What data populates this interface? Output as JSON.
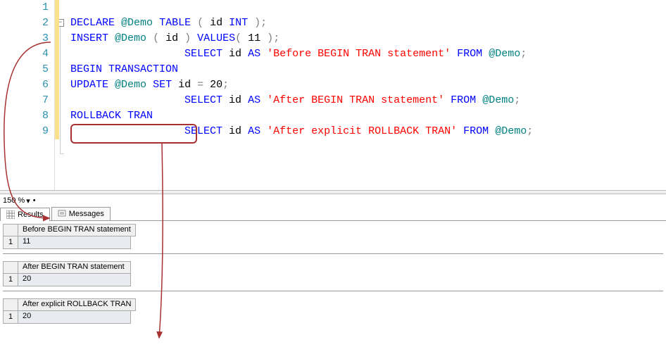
{
  "editor": {
    "lines": [
      {
        "num": "1",
        "tokens": []
      },
      {
        "num": "2",
        "tokens": [
          {
            "t": "DECLARE",
            "c": "kw"
          },
          {
            "t": " ",
            "c": "black"
          },
          {
            "t": "@Demo",
            "c": "var"
          },
          {
            "t": " ",
            "c": "black"
          },
          {
            "t": "TABLE",
            "c": "kw"
          },
          {
            "t": " ",
            "c": "black"
          },
          {
            "t": "(",
            "c": "op"
          },
          {
            "t": " id ",
            "c": "black"
          },
          {
            "t": "INT",
            "c": "kw"
          },
          {
            "t": " ",
            "c": "black"
          },
          {
            "t": ")",
            "c": "op"
          },
          {
            "t": ";",
            "c": "op"
          }
        ]
      },
      {
        "num": "3",
        "tokens": [
          {
            "t": "INSERT",
            "c": "kw"
          },
          {
            "t": " ",
            "c": "black"
          },
          {
            "t": "@Demo",
            "c": "var"
          },
          {
            "t": " ",
            "c": "black"
          },
          {
            "t": "(",
            "c": "op"
          },
          {
            "t": " id ",
            "c": "black"
          },
          {
            "t": ")",
            "c": "op"
          },
          {
            "t": " ",
            "c": "black"
          },
          {
            "t": "VALUES",
            "c": "kw"
          },
          {
            "t": "(",
            "c": "op"
          },
          {
            "t": " 11 ",
            "c": "black"
          },
          {
            "t": ")",
            "c": "op"
          },
          {
            "t": ";",
            "c": "op"
          }
        ]
      },
      {
        "num": "4",
        "tokens": [
          {
            "t": "                  ",
            "c": "black"
          },
          {
            "t": "SELECT",
            "c": "kw"
          },
          {
            "t": " id ",
            "c": "black"
          },
          {
            "t": "AS",
            "c": "kw"
          },
          {
            "t": " ",
            "c": "black"
          },
          {
            "t": "'Before BEGIN TRAN statement'",
            "c": "str"
          },
          {
            "t": " ",
            "c": "black"
          },
          {
            "t": "FROM",
            "c": "kw"
          },
          {
            "t": " ",
            "c": "black"
          },
          {
            "t": "@Demo",
            "c": "var"
          },
          {
            "t": ";",
            "c": "op"
          }
        ]
      },
      {
        "num": "5",
        "tokens": [
          {
            "t": "BEGIN",
            "c": "kw"
          },
          {
            "t": " ",
            "c": "black"
          },
          {
            "t": "TRANSACTION",
            "c": "kw"
          }
        ]
      },
      {
        "num": "6",
        "tokens": [
          {
            "t": "UPDATE",
            "c": "kw"
          },
          {
            "t": " ",
            "c": "black"
          },
          {
            "t": "@Demo",
            "c": "var"
          },
          {
            "t": " ",
            "c": "black"
          },
          {
            "t": "SET",
            "c": "kw"
          },
          {
            "t": " id ",
            "c": "black"
          },
          {
            "t": "=",
            "c": "op"
          },
          {
            "t": " 20",
            "c": "black"
          },
          {
            "t": ";",
            "c": "op"
          }
        ]
      },
      {
        "num": "7",
        "tokens": [
          {
            "t": "                  ",
            "c": "black"
          },
          {
            "t": "SELECT",
            "c": "kw"
          },
          {
            "t": " id ",
            "c": "black"
          },
          {
            "t": "AS",
            "c": "kw"
          },
          {
            "t": " ",
            "c": "black"
          },
          {
            "t": "'After BEGIN TRAN statement'",
            "c": "str"
          },
          {
            "t": " ",
            "c": "black"
          },
          {
            "t": "FROM",
            "c": "kw"
          },
          {
            "t": " ",
            "c": "black"
          },
          {
            "t": "@Demo",
            "c": "var"
          },
          {
            "t": ";",
            "c": "op"
          }
        ]
      },
      {
        "num": "8",
        "tokens": [
          {
            "t": "ROLLBACK",
            "c": "kw"
          },
          {
            "t": " ",
            "c": "black"
          },
          {
            "t": "TRAN",
            "c": "kw"
          }
        ]
      },
      {
        "num": "9",
        "tokens": [
          {
            "t": "                  ",
            "c": "black"
          },
          {
            "t": "SELECT",
            "c": "kw"
          },
          {
            "t": " id ",
            "c": "black"
          },
          {
            "t": "AS",
            "c": "kw"
          },
          {
            "t": " ",
            "c": "black"
          },
          {
            "t": "'After explicit ROLLBACK TRAN'",
            "c": "str"
          },
          {
            "t": " ",
            "c": "black"
          },
          {
            "t": "FROM",
            "c": "kw"
          },
          {
            "t": " ",
            "c": "black"
          },
          {
            "t": "@Demo",
            "c": "var"
          },
          {
            "t": ";",
            "c": "op"
          }
        ]
      }
    ],
    "collapse_symbol": "−"
  },
  "zoom": {
    "value": "150 %",
    "dropdown_symbol": "▾",
    "bullet": "•"
  },
  "tabs": {
    "results": "Results",
    "messages": "Messages"
  },
  "results": [
    {
      "header": "Before BEGIN TRAN statement",
      "row_num": "1",
      "value": "11"
    },
    {
      "header": "After BEGIN TRAN statement",
      "row_num": "1",
      "value": "20"
    },
    {
      "header": "After explicit ROLLBACK TRAN",
      "row_num": "1",
      "value": "20"
    }
  ]
}
